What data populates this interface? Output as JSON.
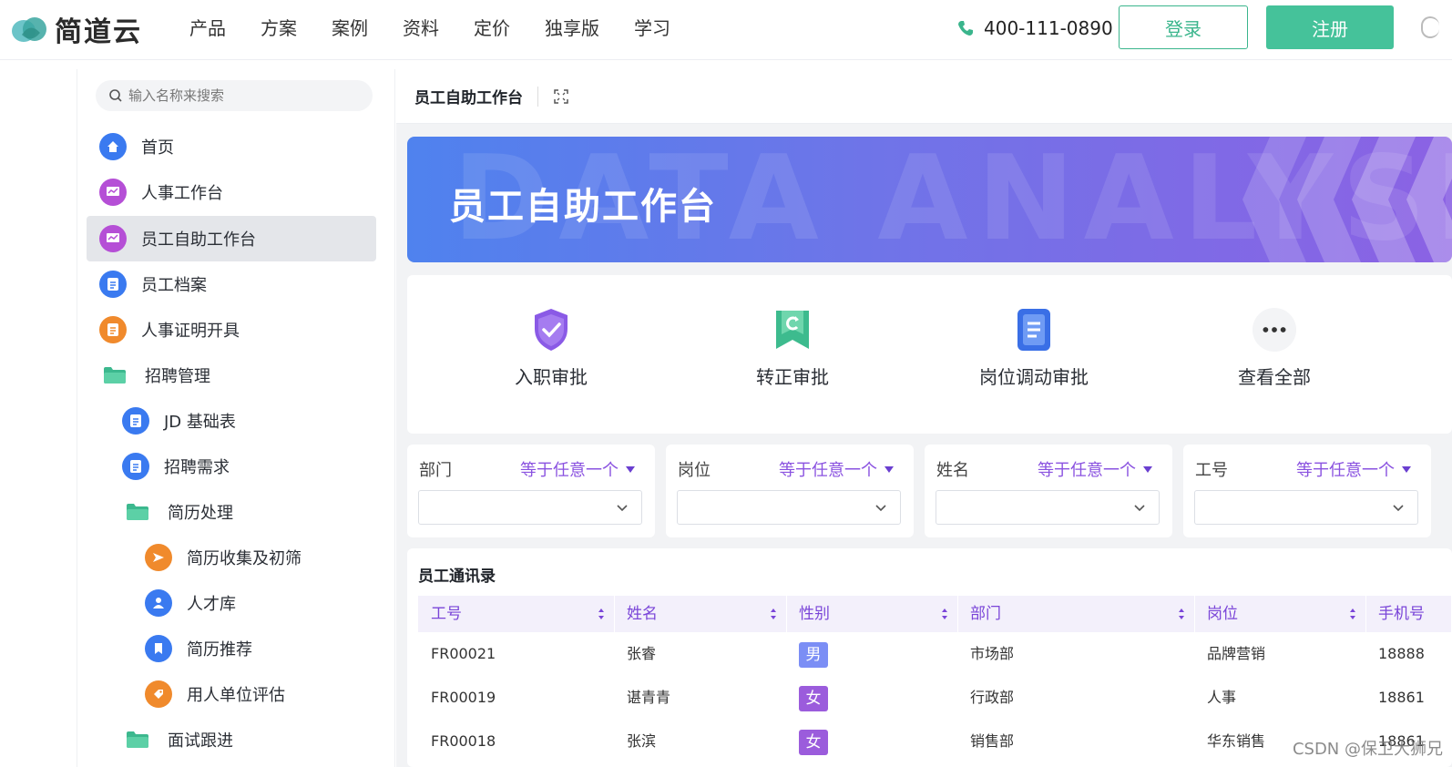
{
  "brand": {
    "name": "简道云"
  },
  "nav": {
    "items": [
      "产品",
      "方案",
      "案例",
      "资料",
      "定价",
      "独享版",
      "学习"
    ],
    "phone": "400-111-0890",
    "login": "登录",
    "register": "注册"
  },
  "sidebar": {
    "search_placeholder": "输入名称来搜索",
    "items": [
      {
        "label": "首页",
        "icon": "home-icon",
        "color": "#3a7af0"
      },
      {
        "label": "人事工作台",
        "icon": "dashboard-icon",
        "color": "#b54fd6"
      },
      {
        "label": "员工自助工作台",
        "icon": "dashboard-icon",
        "color": "#b54fd6"
      },
      {
        "label": "员工档案",
        "icon": "document-icon",
        "color": "#3a7af0"
      },
      {
        "label": "人事证明开具",
        "icon": "document-icon",
        "color": "#f08a2c"
      },
      {
        "label": "招聘管理",
        "icon": "folder-icon",
        "color": "#3cb88e"
      },
      {
        "label": "JD 基础表",
        "icon": "document-icon",
        "color": "#3a7af0"
      },
      {
        "label": "招聘需求",
        "icon": "document-icon",
        "color": "#3a7af0"
      },
      {
        "label": "简历处理",
        "icon": "folder-icon",
        "color": "#3cb88e"
      },
      {
        "label": "简历收集及初筛",
        "icon": "send-icon",
        "color": "#f08a2c"
      },
      {
        "label": "人才库",
        "icon": "people-icon",
        "color": "#3a7af0"
      },
      {
        "label": "简历推荐",
        "icon": "bookmark-icon",
        "color": "#3a7af0"
      },
      {
        "label": "用人单位评估",
        "icon": "tag-icon",
        "color": "#f08a2c"
      },
      {
        "label": "面试跟进",
        "icon": "folder-icon",
        "color": "#3cb88e"
      }
    ]
  },
  "main": {
    "header_title": "员工自助工作台",
    "banner_title": "员工自助工作台",
    "banner_bg_text": "DATA ANALYSIS",
    "quick_actions": [
      {
        "label": "入职审批",
        "icon": "shield-check-icon"
      },
      {
        "label": "转正审批",
        "icon": "flag-refresh-icon"
      },
      {
        "label": "岗位调动审批",
        "icon": "clipboard-icon"
      },
      {
        "label": "查看全部",
        "icon": "more-icon"
      }
    ],
    "filters": [
      {
        "label": "部门",
        "op": "等于任意一个"
      },
      {
        "label": "岗位",
        "op": "等于任意一个"
      },
      {
        "label": "姓名",
        "op": "等于任意一个"
      },
      {
        "label": "工号",
        "op": "等于任意一个"
      }
    ],
    "table": {
      "title": "员工通讯录",
      "columns": [
        "工号",
        "姓名",
        "性别",
        "部门",
        "岗位",
        "手机号"
      ],
      "rows": [
        {
          "id": "FR00021",
          "name": "张睿",
          "gender": "男",
          "dept": "市场部",
          "post": "品牌营销",
          "phone": "18888"
        },
        {
          "id": "FR00019",
          "name": "谌青青",
          "gender": "女",
          "dept": "行政部",
          "post": "人事",
          "phone": "18861"
        },
        {
          "id": "FR00018",
          "name": "张滨",
          "gender": "女",
          "dept": "销售部",
          "post": "华东销售",
          "phone": "18861"
        }
      ]
    }
  },
  "watermark": "CSDN @保卫大狮兄",
  "colors": {
    "accent": "#45c29a",
    "purple": "#7a45d8",
    "male": "#7b8ef5",
    "female": "#9b5cdc"
  }
}
